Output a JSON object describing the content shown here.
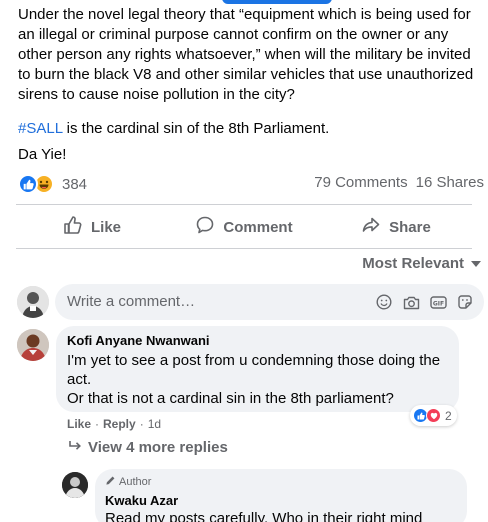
{
  "post": {
    "paragraph1": "Under the novel legal theory that “equipment which is being used for an illegal or criminal purpose cannot confirm on the owner or any other person any rights whatsoever,” when will the military be invited to burn the black V8 and other similar vehicles that use unauthorized sirens to cause noise pollution in the city?",
    "hashtag": "#SALL",
    "paragraph2_rest": " is the cardinal sin of the 8th Parliament.",
    "paragraph3": "Da Yie!"
  },
  "stats": {
    "reaction_count": "384",
    "comments": "79 Comments",
    "shares": "16 Shares"
  },
  "actions": {
    "like": "Like",
    "comment": "Comment",
    "share": "Share"
  },
  "sort_label": "Most Relevant",
  "comment_input": {
    "placeholder": "Write a comment…"
  },
  "comment": {
    "author": "Kofi Anyane Nwanwani",
    "line1": "I'm yet to see a post from u condemning those doing the act.",
    "line2": "Or that is not a cardinal sin in the 8th parliament?",
    "reaction_count": "2",
    "like": "Like",
    "reply": "Reply",
    "time": "1d",
    "view_more": "View 4 more replies"
  },
  "reply": {
    "badge": "Author",
    "author": "Kwaku Azar",
    "text": "Read my posts carefully. Who in their right mind"
  },
  "colors": {
    "link": "#216fdb",
    "muted": "#65676b",
    "like_blue": "#1877f2",
    "love_red": "#f33e58",
    "haha_yellow": "#f7b125",
    "bubble_bg": "#f0f2f5"
  }
}
